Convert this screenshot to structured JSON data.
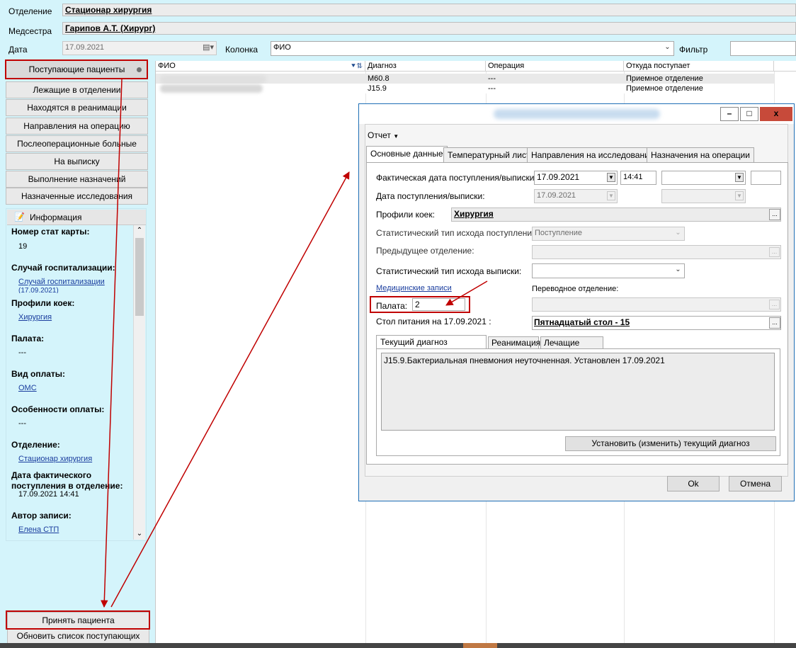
{
  "header": {
    "department_label": "Отделение",
    "department_value": "Стационар хирургия",
    "nurse_label": "Медсестра",
    "nurse_value": "Гарипов А.Т. (Хирург)",
    "date_label": "Дата",
    "date_value": "17.09.2021",
    "column_label": "Колонка",
    "column_value": "ФИО",
    "filter_label": "Фильтр",
    "filter_value": ""
  },
  "nav": {
    "items": [
      "Поступающие пациенты",
      "Лежащие в отделении",
      "Находятся в реанимации",
      "Направления на операцию",
      "Послеоперационные больные",
      "На выписку",
      "Выполнение назначений",
      "Назначенные исследования"
    ],
    "accept_patient": "Принять пациента",
    "refresh_list": "Обновить список поступающих"
  },
  "info": {
    "title": "Информация",
    "stat_card_label": "Номер стат карты:",
    "stat_card_value": "19",
    "hosp_case_label": "Случай госпитализации:",
    "hosp_case_value": "Случай госпитализации",
    "hosp_case_date": "(17.09.2021)",
    "bed_profiles_label": "Профили коек:",
    "bed_profiles_value": "Хирургия",
    "ward_label": "Палата:",
    "ward_value": "---",
    "payment_label": "Вид оплаты:",
    "payment_value": "ОМС",
    "payment_features_label": "Особенности оплаты:",
    "payment_features_value": "---",
    "dept_label": "Отделение:",
    "dept_value": "Стационар хирургия",
    "actual_date_label1": "Дата фактического",
    "actual_date_label2": "поступления в отделение:",
    "actual_date_value": "17.09.2021 14:41",
    "author_label": "Автор записи:",
    "author_value": "Елена СТП"
  },
  "grid": {
    "columns": [
      "ФИО",
      "Диагноз",
      "Операция",
      "Откуда поступает"
    ],
    "rows": [
      {
        "diag": "M60.8",
        "op": "---",
        "from": "Приемное отделение"
      },
      {
        "diag": "J15.9",
        "op": "---",
        "from": "Приемное отделение"
      }
    ]
  },
  "dialog": {
    "window_controls": [
      "–",
      "□",
      "x"
    ],
    "menu_report": "Отчет",
    "tabs": [
      "Основные данные",
      "Температурный лист",
      "Направления на исследования",
      "Назначения на операции"
    ],
    "actual_date_label": "Фактическая дата поступления/выписки:",
    "actual_date": "17.09.2021",
    "actual_time": "14:41",
    "date_label": "Дата поступления/выписки:",
    "date_value": "17.09.2021",
    "bed_profiles_label": "Профили коек:",
    "bed_profiles_value": "Хирургия",
    "stat_type_in_label": "Статистический тип исхода поступления:",
    "stat_type_in_value": "Поступление",
    "prev_dept_label": "Предыдущее отделение:",
    "stat_type_out_label": "Статистический тип исхода выписки:",
    "medical_records_link": "Медицинские записи",
    "transfer_dept_label": "Переводное отделение:",
    "ward_label": "Палата:",
    "ward_value": "2",
    "diet_label": "Стол питания на 17.09.2021 :",
    "diet_value": "Пятнадцатый стол - 15",
    "subtabs": [
      "Текущий диагноз отделения",
      "Реанимация",
      "Лечащие врачи"
    ],
    "diagnosis_text": "J15.9.Бактериальная пневмония неуточненная. Установлен 17.09.2021",
    "set_diagnosis_button": "Установить (изменить) текущий диагноз",
    "ok_button": "Ok",
    "cancel_button": "Отмена"
  },
  "colors": {
    "background": "#d4f4fb",
    "annotation_red": "#c00000",
    "dialog_border": "#1e6fb5",
    "link_blue": "#1a3d9e"
  }
}
